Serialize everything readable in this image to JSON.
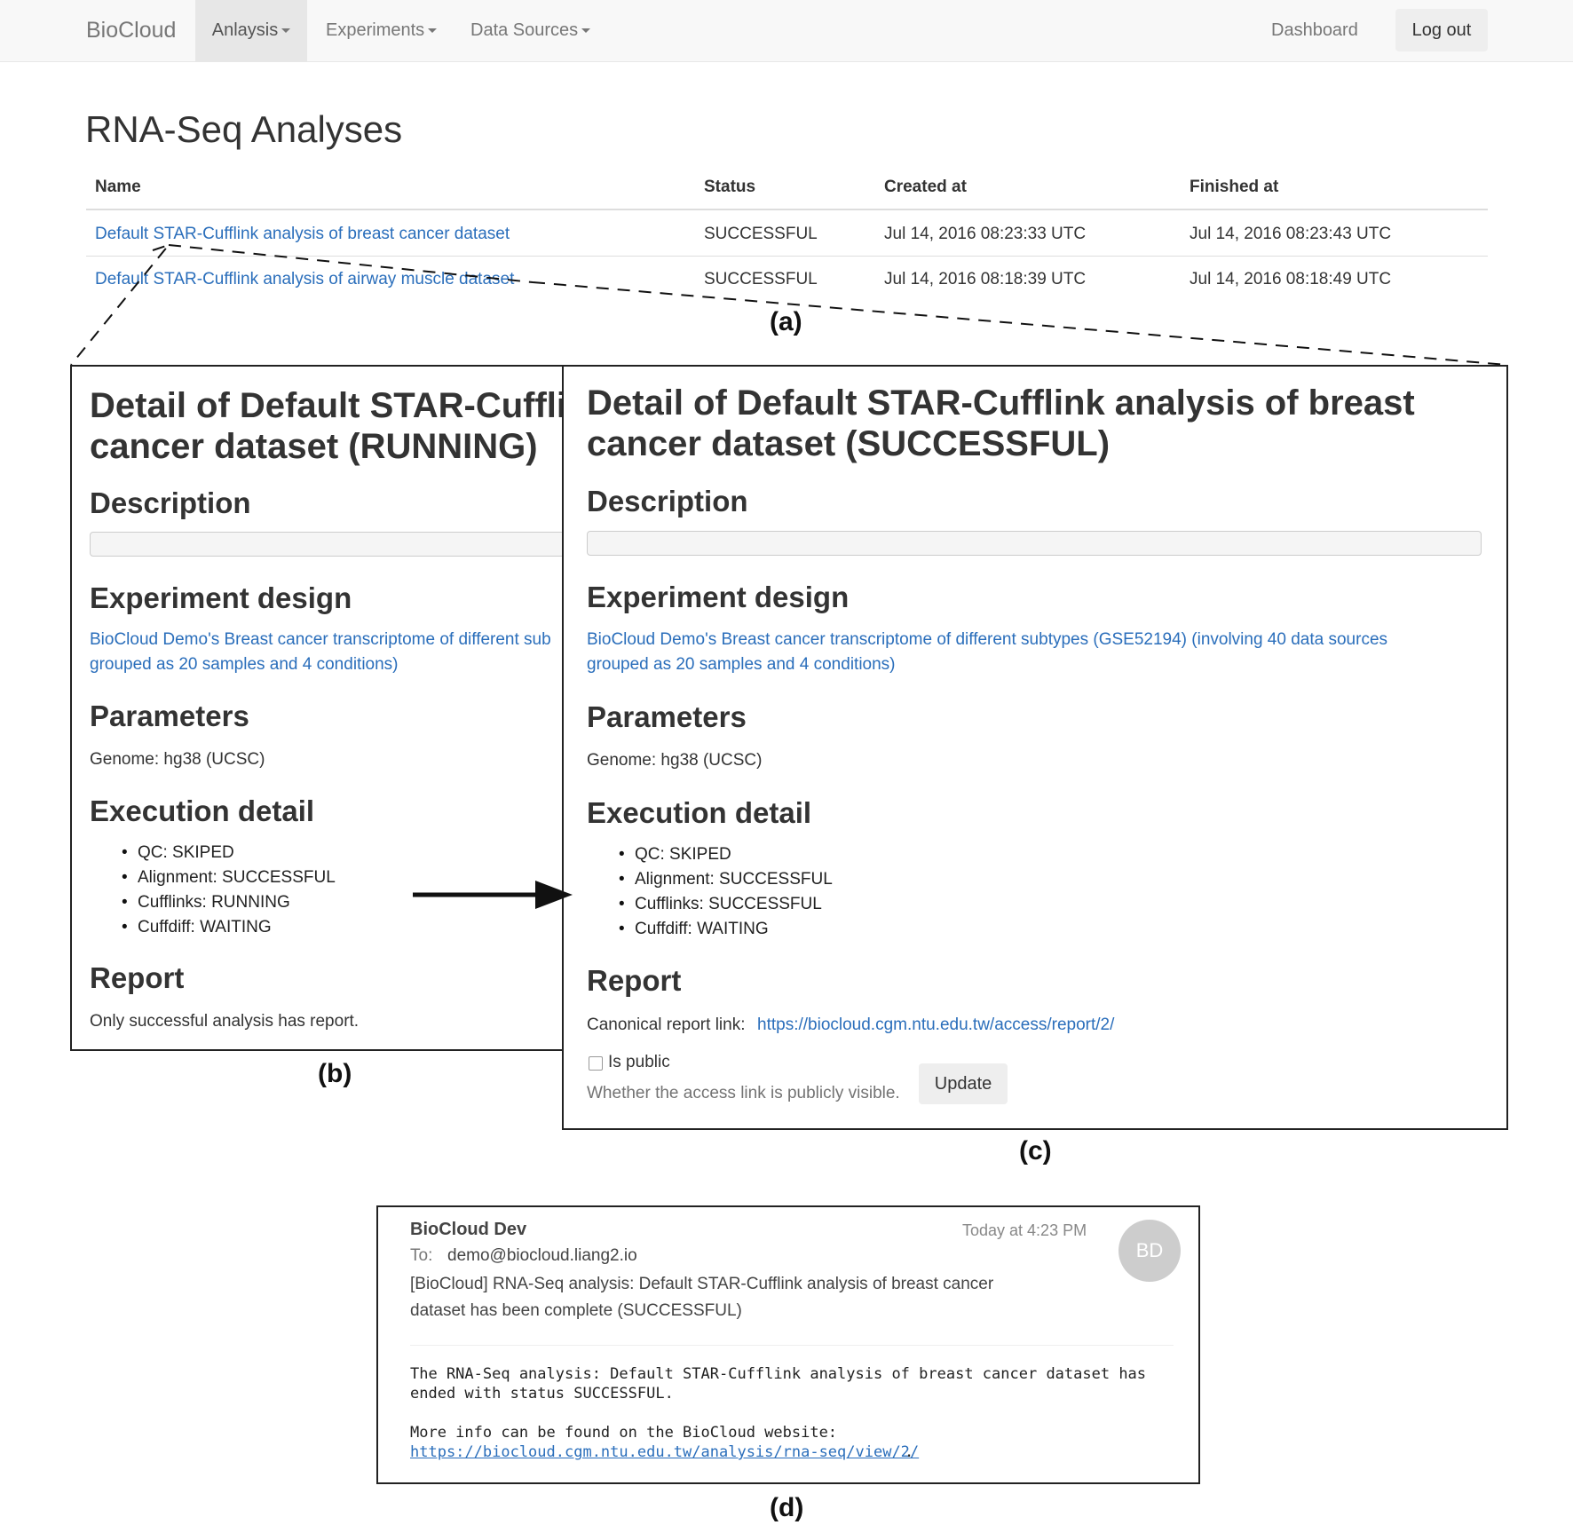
{
  "navbar": {
    "brand": "BioCloud",
    "menu": [
      {
        "label": "Anlaysis"
      },
      {
        "label": "Experiments"
      },
      {
        "label": "Data Sources"
      }
    ],
    "dashboard": "Dashboard",
    "logout": "Log out"
  },
  "list": {
    "title": "RNA-Seq Analyses",
    "columns": [
      "Name",
      "Status",
      "Created at",
      "Finished at"
    ],
    "rows": [
      {
        "name": "Default STAR-Cufflink analysis of breast cancer dataset",
        "status": "SUCCESSFUL",
        "created": "Jul 14, 2016 08:23:33 UTC",
        "finished": "Jul 14, 2016 08:23:43 UTC"
      },
      {
        "name": "Default STAR-Cufflink analysis of airway muscle dataset",
        "status": "SUCCESSFUL",
        "created": "Jul 14, 2016 08:18:39 UTC",
        "finished": "Jul 14, 2016 08:18:49 UTC"
      }
    ]
  },
  "captions": {
    "a": "(a)",
    "b": "(b)",
    "c": "(c)",
    "d": "(d)"
  },
  "panel_b": {
    "title_line1": "Detail of Default STAR-Cuffli",
    "title_line2": "cancer dataset (RUNNING)",
    "description_heading": "Description",
    "experiment_heading": "Experiment design",
    "experiment_link_line1": "BioCloud Demo's Breast cancer transcriptome of different sub",
    "experiment_link_line2": "grouped as 20 samples and 4 conditions)",
    "parameters_heading": "Parameters",
    "genome": "Genome: hg38 (UCSC)",
    "execution_heading": "Execution detail",
    "steps": [
      "QC: SKIPED",
      "Alignment: SUCCESSFUL",
      "Cufflinks: RUNNING",
      "Cuffdiff: WAITING"
    ],
    "report_heading": "Report",
    "report_text": "Only successful analysis has report."
  },
  "panel_c": {
    "title_line1": "Detail of Default STAR-Cufflink analysis of breast",
    "title_line2": "cancer dataset (SUCCESSFUL)",
    "description_heading": "Description",
    "experiment_heading": "Experiment design",
    "experiment_link_line1": "BioCloud Demo's Breast cancer transcriptome of different subtypes (GSE52194) (involving 40 data sources",
    "experiment_link_line2": "grouped as 20 samples and 4 conditions)",
    "parameters_heading": "Parameters",
    "genome": "Genome: hg38 (UCSC)",
    "execution_heading": "Execution detail",
    "steps": [
      "QC: SKIPED",
      "Alignment: SUCCESSFUL",
      "Cufflinks: SUCCESSFUL",
      "Cuffdiff: WAITING"
    ],
    "report_heading": "Report",
    "report_label": "Canonical report link:",
    "report_link": "https://biocloud.cgm.ntu.edu.tw/access/report/2/",
    "public_label": "Is public",
    "public_help": "Whether the access link is publicly visible.",
    "update_button": "Update"
  },
  "email": {
    "sender": "BioCloud Dev",
    "time": "Today at 4:23 PM",
    "to_label": "To:",
    "to_address": "demo@biocloud.liang2.io",
    "subject_line1": "[BioCloud] RNA-Seq analysis: Default STAR-Cufflink analysis of breast cancer",
    "subject_line2": "dataset has been complete (SUCCESSFUL)",
    "avatar": "BD",
    "body_line1": "The RNA-Seq analysis: Default STAR-Cufflink analysis of breast cancer dataset has",
    "body_line2": "ended with status SUCCESSFUL.",
    "body_line3": "More info can be found on the BioCloud website:",
    "body_link": "https://biocloud.cgm.ntu.edu.tw/analysis/rna-seq/view/2/",
    "body_end": "."
  }
}
